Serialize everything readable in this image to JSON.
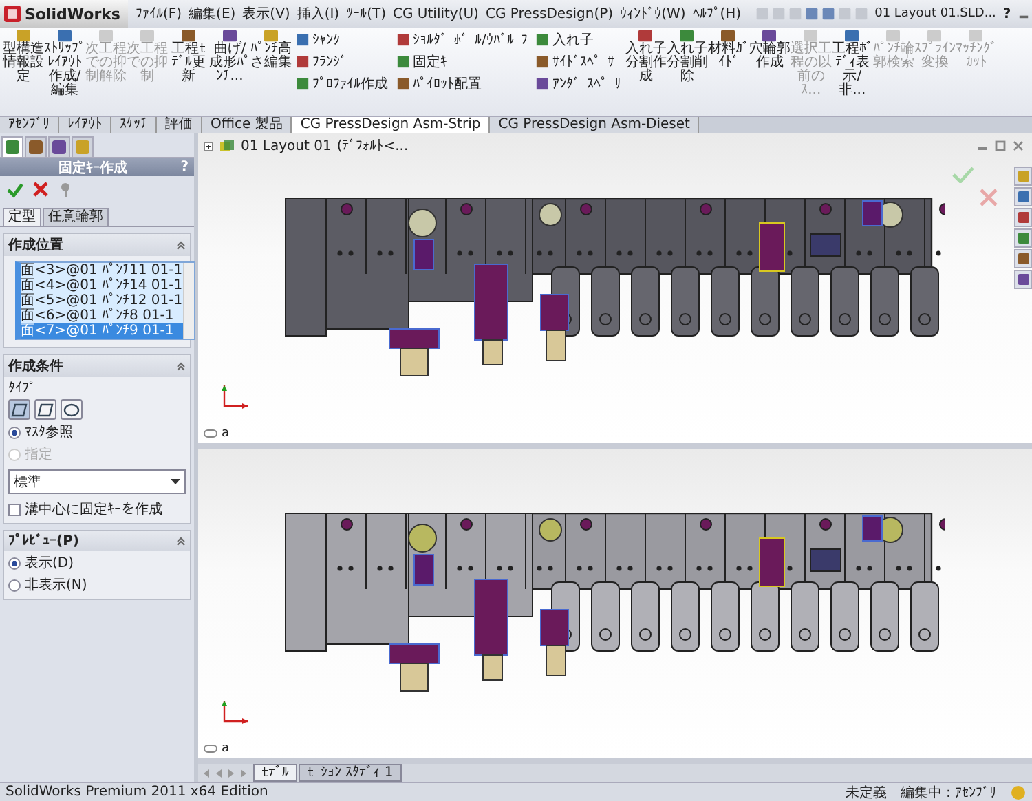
{
  "app": {
    "name": "SolidWorks",
    "document_title": "01 Layout 01.SLD...",
    "help": "?"
  },
  "menus": [
    "ﾌｧｲﾙ(F)",
    "編集(E)",
    "表示(V)",
    "挿入(I)",
    "ﾂｰﾙ(T)",
    "CG Utility(U)",
    "CG PressDesign(P)",
    "ｳｨﾝﾄﾞｳ(W)",
    "ﾍﾙﾌﾟ(H)"
  ],
  "ribbon": {
    "large_left": [
      {
        "label": "型構造情報設定",
        "disabled": false
      },
      {
        "label": "ｽﾄﾘｯﾌﾟﾚｲｱｳﾄ作成/編集",
        "disabled": false
      },
      {
        "label": "次工程での抑制解除",
        "disabled": true
      },
      {
        "label": "次工程での抑制",
        "disabled": true
      },
      {
        "label": "工程ﾓﾃﾞﾙ更新",
        "disabled": false
      },
      {
        "label": "曲げ/成形ﾊﾟﾝﾁ...",
        "disabled": false
      },
      {
        "label": "ﾊﾟﾝﾁ高さ編集",
        "disabled": false
      }
    ],
    "small_columns": [
      [
        {
          "label": "ｼｬﾝｸ",
          "disabled": false
        },
        {
          "label": "ﾌﾗﾝｼﾞ",
          "disabled": false
        },
        {
          "label": "ﾌﾟﾛﾌｧｲﾙ作成",
          "disabled": false
        }
      ],
      [
        {
          "label": "ｼｮﾙﾀﾞｰﾎﾞｰﾙ/ｳﾊﾞﾙｰﾌ",
          "disabled": false
        },
        {
          "label": "固定ｷｰ",
          "disabled": false
        },
        {
          "label": "ﾊﾟｲﾛｯﾄ配置",
          "disabled": false
        }
      ],
      [
        {
          "label": "入れ子",
          "disabled": false
        },
        {
          "label": "ｻｲﾄﾞｽﾍﾟｰｻ",
          "disabled": false
        },
        {
          "label": "ｱﾝﾀﾞｰｽﾍﾟｰｻ",
          "disabled": false
        }
      ]
    ],
    "large_right": [
      {
        "label": "入れ子分割作成",
        "disabled": false
      },
      {
        "label": "入れ子分割削除",
        "disabled": false
      },
      {
        "label": "材料ｶﾞｲﾄﾞ",
        "disabled": false
      },
      {
        "label": "穴輪郭作成",
        "disabled": false
      },
      {
        "label": "選択工程の以前のｽ...",
        "disabled": true
      },
      {
        "label": "工程ﾎﾞﾃﾞｨ表示/非...",
        "disabled": false
      },
      {
        "label": "ﾊﾟﾝﾁ輪郭検索",
        "disabled": true
      },
      {
        "label": "ｽﾌﾟﾗｲﾝ変換",
        "disabled": true
      },
      {
        "label": "ﾏｯﾁﾝｸﾞｶｯﾄ",
        "disabled": true
      }
    ]
  },
  "ribbon_tabs": [
    {
      "label": "ｱｾﾝﾌﾞﾘ",
      "selected": false
    },
    {
      "label": "ﾚｲｱｳﾄ",
      "selected": false
    },
    {
      "label": "ｽｹｯﾁ",
      "selected": false
    },
    {
      "label": "評価",
      "selected": false
    },
    {
      "label": "Office 製品",
      "selected": false
    },
    {
      "label": "CG PressDesign Asm-Strip",
      "selected": true
    },
    {
      "label": "CG PressDesign Asm-Dieset",
      "selected": false
    }
  ],
  "panel": {
    "tabs": [
      {
        "selected": true
      },
      {
        "selected": false
      },
      {
        "selected": false
      },
      {
        "selected": false
      }
    ],
    "title": "固定ｷｰ作成",
    "help": "?",
    "sub_tabs": [
      {
        "label": "定型",
        "selected": true
      },
      {
        "label": "任意輪郭",
        "selected": false
      }
    ],
    "position_section": {
      "title": "作成位置",
      "items": [
        {
          "label": "面<3>@01 ﾊﾟﾝﾁ11 01-1",
          "selected": false
        },
        {
          "label": "面<4>@01 ﾊﾟﾝﾁ14 01-1",
          "selected": false
        },
        {
          "label": "面<5>@01 ﾊﾟﾝﾁ12 01-1",
          "selected": false
        },
        {
          "label": "面<6>@01 ﾊﾟﾝﾁ8 01-1",
          "selected": false
        },
        {
          "label": "面<7>@01 ﾊﾟﾝﾁ9 01-1",
          "selected": true
        }
      ]
    },
    "condition_section": {
      "title": "作成条件",
      "type_label": "ﾀｲﾌﾟ",
      "types": [
        {
          "selected": true
        },
        {
          "selected": false
        },
        {
          "selected": false
        }
      ],
      "radios": [
        {
          "label": "ﾏｽﾀ参照",
          "selected": true,
          "disabled": false
        },
        {
          "label": "指定",
          "selected": false,
          "disabled": true
        }
      ],
      "dropdown": "標準",
      "checkbox": {
        "label": "溝中心に固定ｷｰを作成",
        "checked": false
      }
    },
    "preview_section": {
      "title": "ﾌﾟﾚﾋﾞｭｰ(P)",
      "radios": [
        {
          "label": "表示(D)",
          "selected": true
        },
        {
          "label": "非表示(N)",
          "selected": false
        }
      ]
    }
  },
  "viewport": {
    "tree_label": "01 Layout 01",
    "tree_config": "(ﾃﾞﾌｫﾙﾄ<...",
    "pane_labels": [
      "a",
      "a"
    ]
  },
  "bottom_tabs": [
    {
      "label": "ﾓﾃﾞﾙ",
      "selected": true
    },
    {
      "label": "ﾓｰｼｮﾝ ｽﾀﾃﾞｨ 1",
      "selected": false
    }
  ],
  "status_bar": {
    "product": "SolidWorks Premium 2011 x64 Edition",
    "state": "未定義",
    "mode": "編集中 : ｱｾﾝﾌﾞﾘ"
  }
}
